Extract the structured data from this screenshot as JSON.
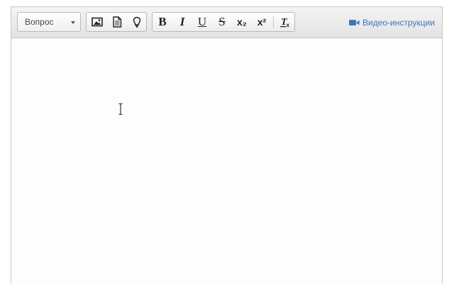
{
  "toolbar": {
    "format_select": {
      "selected": "Вопрос"
    },
    "insert_buttons": [
      {
        "icon": "image-icon"
      },
      {
        "icon": "document-icon"
      },
      {
        "icon": "lightbulb-icon"
      }
    ],
    "format_buttons": {
      "bold": "B",
      "italic": "I",
      "underline": "U",
      "strike": "S",
      "subscript": "x₂",
      "superscript": "x²",
      "clear_format": {
        "icon": "remove-format-icon"
      }
    },
    "video_link": {
      "label": "Видео-инструкции",
      "icon": "video-camera-icon"
    }
  },
  "colors": {
    "accent": "#3e76b9",
    "toolbar_bg": "#ececec",
    "border": "#c8c8c8"
  }
}
